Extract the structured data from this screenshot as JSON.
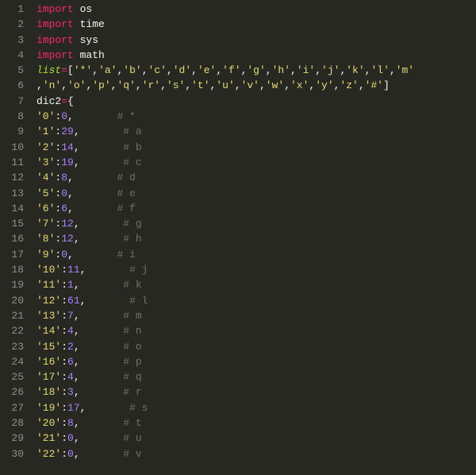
{
  "code_lines": [
    [
      {
        "cls": "kw",
        "t": "import"
      },
      {
        "cls": "pun",
        "t": " "
      },
      {
        "cls": "name",
        "t": "os"
      }
    ],
    [
      {
        "cls": "kw",
        "t": "import"
      },
      {
        "cls": "pun",
        "t": " "
      },
      {
        "cls": "name",
        "t": "time"
      }
    ],
    [
      {
        "cls": "kw",
        "t": "import"
      },
      {
        "cls": "pun",
        "t": " "
      },
      {
        "cls": "name",
        "t": "sys"
      }
    ],
    [
      {
        "cls": "kw",
        "t": "import"
      },
      {
        "cls": "pun",
        "t": " "
      },
      {
        "cls": "name",
        "t": "math"
      }
    ],
    [
      {
        "cls": "var",
        "t": "list"
      },
      {
        "cls": "op",
        "t": "="
      },
      {
        "cls": "pun",
        "t": "["
      },
      {
        "cls": "str",
        "t": "'*'"
      },
      {
        "cls": "pun",
        "t": ","
      },
      {
        "cls": "str",
        "t": "'a'"
      },
      {
        "cls": "pun",
        "t": ","
      },
      {
        "cls": "str",
        "t": "'b'"
      },
      {
        "cls": "pun",
        "t": ","
      },
      {
        "cls": "str",
        "t": "'c'"
      },
      {
        "cls": "pun",
        "t": ","
      },
      {
        "cls": "str",
        "t": "'d'"
      },
      {
        "cls": "pun",
        "t": ","
      },
      {
        "cls": "str",
        "t": "'e'"
      },
      {
        "cls": "pun",
        "t": ","
      },
      {
        "cls": "str",
        "t": "'f'"
      },
      {
        "cls": "pun",
        "t": ","
      },
      {
        "cls": "str",
        "t": "'g'"
      },
      {
        "cls": "pun",
        "t": ","
      },
      {
        "cls": "str",
        "t": "'h'"
      },
      {
        "cls": "pun",
        "t": ","
      },
      {
        "cls": "str",
        "t": "'i'"
      },
      {
        "cls": "pun",
        "t": ","
      },
      {
        "cls": "str",
        "t": "'j'"
      },
      {
        "cls": "pun",
        "t": ","
      },
      {
        "cls": "str",
        "t": "'k'"
      },
      {
        "cls": "pun",
        "t": ","
      },
      {
        "cls": "str",
        "t": "'l'"
      },
      {
        "cls": "pun",
        "t": ","
      },
      {
        "cls": "str",
        "t": "'m'"
      }
    ],
    [
      {
        "cls": "pun",
        "t": ","
      },
      {
        "cls": "str",
        "t": "'n'"
      },
      {
        "cls": "pun",
        "t": ","
      },
      {
        "cls": "str",
        "t": "'o'"
      },
      {
        "cls": "pun",
        "t": ","
      },
      {
        "cls": "str",
        "t": "'p'"
      },
      {
        "cls": "pun",
        "t": ","
      },
      {
        "cls": "str",
        "t": "'q'"
      },
      {
        "cls": "pun",
        "t": ","
      },
      {
        "cls": "str",
        "t": "'r'"
      },
      {
        "cls": "pun",
        "t": ","
      },
      {
        "cls": "str",
        "t": "'s'"
      },
      {
        "cls": "pun",
        "t": ","
      },
      {
        "cls": "str",
        "t": "'t'"
      },
      {
        "cls": "pun",
        "t": ","
      },
      {
        "cls": "str",
        "t": "'u'"
      },
      {
        "cls": "pun",
        "t": ","
      },
      {
        "cls": "str",
        "t": "'v'"
      },
      {
        "cls": "pun",
        "t": ","
      },
      {
        "cls": "str",
        "t": "'w'"
      },
      {
        "cls": "pun",
        "t": ","
      },
      {
        "cls": "str",
        "t": "'x'"
      },
      {
        "cls": "pun",
        "t": ","
      },
      {
        "cls": "str",
        "t": "'y'"
      },
      {
        "cls": "pun",
        "t": ","
      },
      {
        "cls": "str",
        "t": "'z'"
      },
      {
        "cls": "pun",
        "t": ","
      },
      {
        "cls": "str",
        "t": "'#'"
      },
      {
        "cls": "pun",
        "t": "]"
      }
    ],
    [
      {
        "cls": "name",
        "t": "dic2"
      },
      {
        "cls": "op",
        "t": "="
      },
      {
        "cls": "pun",
        "t": "{"
      }
    ],
    [
      {
        "cls": "str",
        "t": "'0'"
      },
      {
        "cls": "pun",
        "t": ":"
      },
      {
        "cls": "num",
        "t": "0"
      },
      {
        "cls": "pun",
        "t": ","
      },
      {
        "cls": "pad",
        "t": "       "
      },
      {
        "cls": "cmt",
        "t": "# *"
      }
    ],
    [
      {
        "cls": "str",
        "t": "'1'"
      },
      {
        "cls": "pun",
        "t": ":"
      },
      {
        "cls": "num",
        "t": "29"
      },
      {
        "cls": "pun",
        "t": ","
      },
      {
        "cls": "pad",
        "t": "       "
      },
      {
        "cls": "cmt",
        "t": "# a"
      }
    ],
    [
      {
        "cls": "str",
        "t": "'2'"
      },
      {
        "cls": "pun",
        "t": ":"
      },
      {
        "cls": "num",
        "t": "14"
      },
      {
        "cls": "pun",
        "t": ","
      },
      {
        "cls": "pad",
        "t": "       "
      },
      {
        "cls": "cmt",
        "t": "# b"
      }
    ],
    [
      {
        "cls": "str",
        "t": "'3'"
      },
      {
        "cls": "pun",
        "t": ":"
      },
      {
        "cls": "num",
        "t": "19"
      },
      {
        "cls": "pun",
        "t": ","
      },
      {
        "cls": "pad",
        "t": "       "
      },
      {
        "cls": "cmt",
        "t": "# c"
      }
    ],
    [
      {
        "cls": "str",
        "t": "'4'"
      },
      {
        "cls": "pun",
        "t": ":"
      },
      {
        "cls": "num",
        "t": "8"
      },
      {
        "cls": "pun",
        "t": ","
      },
      {
        "cls": "pad",
        "t": "       "
      },
      {
        "cls": "cmt",
        "t": "# d"
      }
    ],
    [
      {
        "cls": "str",
        "t": "'5'"
      },
      {
        "cls": "pun",
        "t": ":"
      },
      {
        "cls": "num",
        "t": "0"
      },
      {
        "cls": "pun",
        "t": ","
      },
      {
        "cls": "pad",
        "t": "       "
      },
      {
        "cls": "cmt",
        "t": "# e"
      }
    ],
    [
      {
        "cls": "str",
        "t": "'6'"
      },
      {
        "cls": "pun",
        "t": ":"
      },
      {
        "cls": "num",
        "t": "6"
      },
      {
        "cls": "pun",
        "t": ","
      },
      {
        "cls": "pad",
        "t": "       "
      },
      {
        "cls": "cmt",
        "t": "# f"
      }
    ],
    [
      {
        "cls": "str",
        "t": "'7'"
      },
      {
        "cls": "pun",
        "t": ":"
      },
      {
        "cls": "num",
        "t": "12"
      },
      {
        "cls": "pun",
        "t": ","
      },
      {
        "cls": "pad",
        "t": "       "
      },
      {
        "cls": "cmt",
        "t": "# g"
      }
    ],
    [
      {
        "cls": "str",
        "t": "'8'"
      },
      {
        "cls": "pun",
        "t": ":"
      },
      {
        "cls": "num",
        "t": "12"
      },
      {
        "cls": "pun",
        "t": ","
      },
      {
        "cls": "pad",
        "t": "       "
      },
      {
        "cls": "cmt",
        "t": "# h"
      }
    ],
    [
      {
        "cls": "str",
        "t": "'9'"
      },
      {
        "cls": "pun",
        "t": ":"
      },
      {
        "cls": "num",
        "t": "0"
      },
      {
        "cls": "pun",
        "t": ","
      },
      {
        "cls": "pad",
        "t": "       "
      },
      {
        "cls": "cmt",
        "t": "# i"
      }
    ],
    [
      {
        "cls": "str",
        "t": "'10'"
      },
      {
        "cls": "pun",
        "t": ":"
      },
      {
        "cls": "num",
        "t": "11"
      },
      {
        "cls": "pun",
        "t": ","
      },
      {
        "cls": "pad",
        "t": "       "
      },
      {
        "cls": "cmt",
        "t": "# j"
      }
    ],
    [
      {
        "cls": "str",
        "t": "'11'"
      },
      {
        "cls": "pun",
        "t": ":"
      },
      {
        "cls": "num",
        "t": "1"
      },
      {
        "cls": "pun",
        "t": ","
      },
      {
        "cls": "pad",
        "t": "       "
      },
      {
        "cls": "cmt",
        "t": "# k"
      }
    ],
    [
      {
        "cls": "str",
        "t": "'12'"
      },
      {
        "cls": "pun",
        "t": ":"
      },
      {
        "cls": "num",
        "t": "61"
      },
      {
        "cls": "pun",
        "t": ","
      },
      {
        "cls": "pad",
        "t": "       "
      },
      {
        "cls": "cmt",
        "t": "# l"
      }
    ],
    [
      {
        "cls": "str",
        "t": "'13'"
      },
      {
        "cls": "pun",
        "t": ":"
      },
      {
        "cls": "num",
        "t": "7"
      },
      {
        "cls": "pun",
        "t": ","
      },
      {
        "cls": "pad",
        "t": "       "
      },
      {
        "cls": "cmt",
        "t": "# m"
      }
    ],
    [
      {
        "cls": "str",
        "t": "'14'"
      },
      {
        "cls": "pun",
        "t": ":"
      },
      {
        "cls": "num",
        "t": "4"
      },
      {
        "cls": "pun",
        "t": ","
      },
      {
        "cls": "pad",
        "t": "       "
      },
      {
        "cls": "cmt",
        "t": "# n"
      }
    ],
    [
      {
        "cls": "str",
        "t": "'15'"
      },
      {
        "cls": "pun",
        "t": ":"
      },
      {
        "cls": "num",
        "t": "2"
      },
      {
        "cls": "pun",
        "t": ","
      },
      {
        "cls": "pad",
        "t": "       "
      },
      {
        "cls": "cmt",
        "t": "# o"
      }
    ],
    [
      {
        "cls": "str",
        "t": "'16'"
      },
      {
        "cls": "pun",
        "t": ":"
      },
      {
        "cls": "num",
        "t": "6"
      },
      {
        "cls": "pun",
        "t": ","
      },
      {
        "cls": "pad",
        "t": "       "
      },
      {
        "cls": "cmt",
        "t": "# p"
      }
    ],
    [
      {
        "cls": "str",
        "t": "'17'"
      },
      {
        "cls": "pun",
        "t": ":"
      },
      {
        "cls": "num",
        "t": "4"
      },
      {
        "cls": "pun",
        "t": ","
      },
      {
        "cls": "pad",
        "t": "       "
      },
      {
        "cls": "cmt",
        "t": "# q"
      }
    ],
    [
      {
        "cls": "str",
        "t": "'18'"
      },
      {
        "cls": "pun",
        "t": ":"
      },
      {
        "cls": "num",
        "t": "3"
      },
      {
        "cls": "pun",
        "t": ","
      },
      {
        "cls": "pad",
        "t": "       "
      },
      {
        "cls": "cmt",
        "t": "# r"
      }
    ],
    [
      {
        "cls": "str",
        "t": "'19'"
      },
      {
        "cls": "pun",
        "t": ":"
      },
      {
        "cls": "num",
        "t": "17"
      },
      {
        "cls": "pun",
        "t": ","
      },
      {
        "cls": "pad",
        "t": "       "
      },
      {
        "cls": "cmt",
        "t": "# s"
      }
    ],
    [
      {
        "cls": "str",
        "t": "'20'"
      },
      {
        "cls": "pun",
        "t": ":"
      },
      {
        "cls": "num",
        "t": "8"
      },
      {
        "cls": "pun",
        "t": ","
      },
      {
        "cls": "pad",
        "t": "       "
      },
      {
        "cls": "cmt",
        "t": "# t"
      }
    ],
    [
      {
        "cls": "str",
        "t": "'21'"
      },
      {
        "cls": "pun",
        "t": ":"
      },
      {
        "cls": "num",
        "t": "0"
      },
      {
        "cls": "pun",
        "t": ","
      },
      {
        "cls": "pad",
        "t": "       "
      },
      {
        "cls": "cmt",
        "t": "# u"
      }
    ],
    [
      {
        "cls": "str",
        "t": "'22'"
      },
      {
        "cls": "pun",
        "t": ":"
      },
      {
        "cls": "num",
        "t": "0"
      },
      {
        "cls": "pun",
        "t": ","
      },
      {
        "cls": "pad",
        "t": "       "
      },
      {
        "cls": "cmt",
        "t": "# v"
      }
    ]
  ]
}
